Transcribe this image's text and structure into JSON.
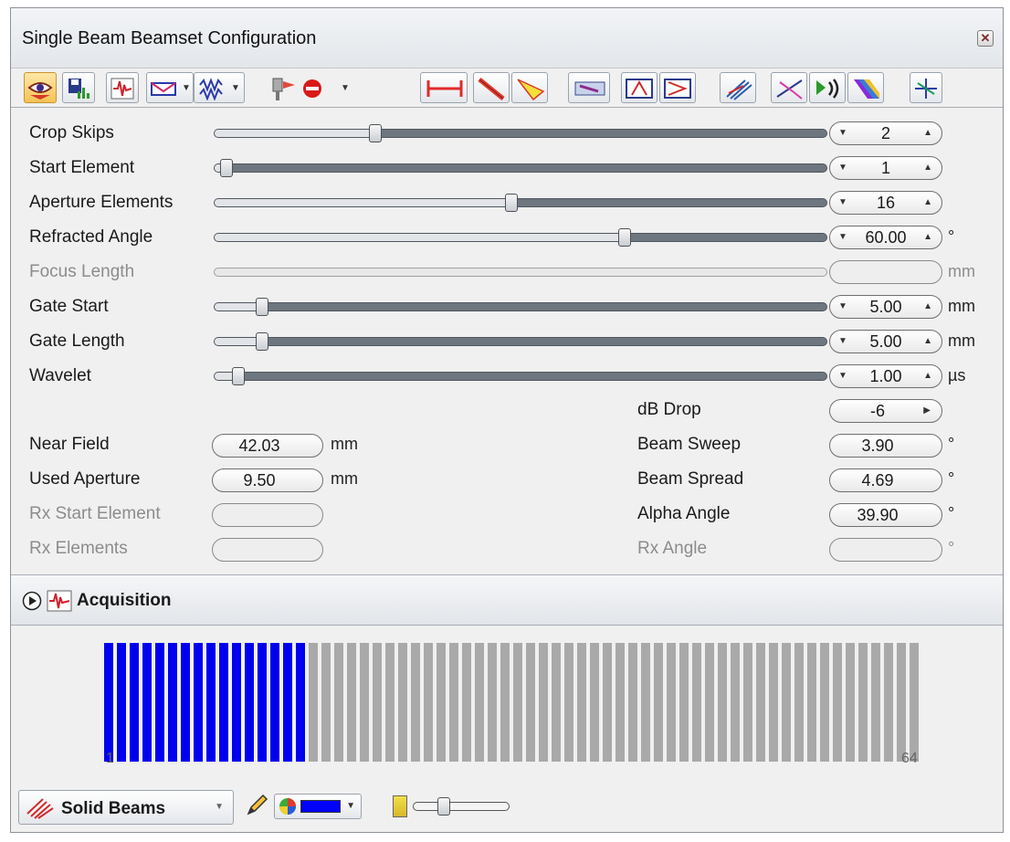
{
  "window": {
    "title": "Single Beam Beamset Configuration"
  },
  "toolbar": {
    "buttons": [
      "view-eye-icon",
      "save-chart-icon",
      "waveform-icon",
      "envelope-icon",
      "wave-icon",
      "probe-stop-icon",
      "gate-width-icon",
      "beam-line-icon",
      "beam-cone-icon",
      "wedge-icon",
      "angle-icon",
      "delay-icon",
      "hatch-icon",
      "refraction-icon",
      "sound-emit-icon",
      "color-beam-icon",
      "crosshair-icon"
    ]
  },
  "sliders": [
    {
      "label": "Crop Skips",
      "value": "2",
      "unit": "",
      "disabled": false,
      "level": 0.25
    },
    {
      "label": "Start Element",
      "value": "1",
      "unit": "",
      "disabled": false,
      "level": 0.0
    },
    {
      "label": "Aperture Elements",
      "value": "16",
      "unit": "",
      "disabled": false,
      "level": 0.48
    },
    {
      "label": "Refracted Angle",
      "value": "60.00",
      "unit": "°",
      "disabled": false,
      "level": 0.67
    },
    {
      "label": "Focus Length",
      "value": "",
      "unit": "mm",
      "disabled": true,
      "level": 0
    },
    {
      "label": "Gate Start",
      "value": "5.00",
      "unit": "mm",
      "disabled": false,
      "level": 0.06
    },
    {
      "label": "Gate Length",
      "value": "5.00",
      "unit": "mm",
      "disabled": false,
      "level": 0.06
    },
    {
      "label": "Wavelet",
      "value": "1.00",
      "unit": "µs",
      "disabled": false,
      "level": 0.02
    }
  ],
  "db_drop": {
    "label": "dB Drop",
    "value": "-6"
  },
  "left_readouts": [
    {
      "label": "Near Field",
      "value": "42.03",
      "unit": "mm",
      "disabled": false
    },
    {
      "label": "Used Aperture",
      "value": "9.50",
      "unit": "mm",
      "disabled": false
    },
    {
      "label": "Rx Start Element",
      "value": "",
      "unit": "",
      "disabled": true
    },
    {
      "label": "Rx Elements",
      "value": "",
      "unit": "",
      "disabled": true
    }
  ],
  "right_readouts": [
    {
      "label": "Beam Sweep",
      "value": "3.90",
      "unit": "°",
      "disabled": false
    },
    {
      "label": "Beam Spread",
      "value": "4.69",
      "unit": "°",
      "disabled": false
    },
    {
      "label": "Alpha Angle",
      "value": "39.90",
      "unit": "°",
      "disabled": false
    },
    {
      "label": "Rx Angle",
      "value": "",
      "unit": "°",
      "disabled": true
    }
  ],
  "acquisition": {
    "title": "Acquisition"
  },
  "elements": {
    "total": 64,
    "active_start": 1,
    "active_count": 16,
    "first_label": "1",
    "last_label": "64",
    "active_color": "#0000ee",
    "inactive_color": "#a9a9a9"
  },
  "bottom": {
    "render_mode": "Solid Beams",
    "beam_color": "#0000ff"
  },
  "colors": {
    "accent": "#0000ee"
  }
}
